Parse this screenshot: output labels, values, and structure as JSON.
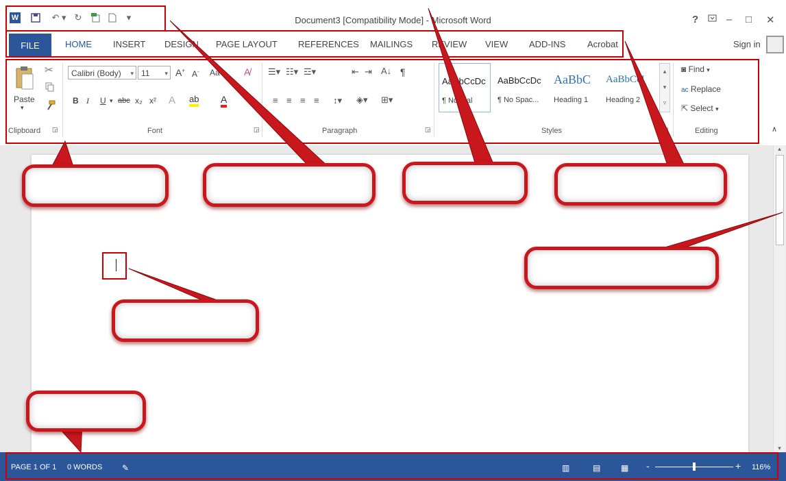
{
  "window": {
    "title": "Document3 [Compatibility Mode] - Microsoft Word",
    "help": "?",
    "controls": [
      "–",
      "□",
      "✕"
    ]
  },
  "tabs": {
    "file": "FILE",
    "items": [
      "HOME",
      "INSERT",
      "DESIGN",
      "PAGE LAYOUT",
      "REFERENCES",
      "MAILINGS",
      "REVIEW",
      "VIEW",
      "ADD-INS",
      "Acrobat"
    ],
    "sign_in": "Sign in"
  },
  "clipboard": {
    "paste": "Paste",
    "group_label": "Clipboard"
  },
  "font": {
    "name": "Calibri (Body)",
    "size": "11",
    "case_button": "Aa",
    "bold": "B",
    "italic": "I",
    "underline": "U",
    "strike": "abc",
    "subscript": "x₂",
    "superscript": "x²",
    "group_label": "Font"
  },
  "paragraph": {
    "group_label": "Paragraph",
    "pilcrow": "¶"
  },
  "styles": {
    "items": [
      {
        "sample": "AaBbCcDc",
        "name": "¶ Normal"
      },
      {
        "sample": "AaBbCcDc",
        "name": "¶ No Spac..."
      },
      {
        "sample": "AaBbC",
        "name": "Heading 1"
      },
      {
        "sample": "AaBbCcI",
        "name": "Heading 2"
      }
    ],
    "group_label": "Styles"
  },
  "editing": {
    "find": "Find",
    "replace": "Replace",
    "select": "Select",
    "group_label": "Editing"
  },
  "statusbar": {
    "page": "PAGE 1 OF 1",
    "words": "0 WORDS",
    "zoom_minus": "-",
    "zoom_plus": "+",
    "zoom": "116%"
  },
  "colors": {
    "word_blue": "#2b579a",
    "annotation_red": "#c8171d"
  }
}
